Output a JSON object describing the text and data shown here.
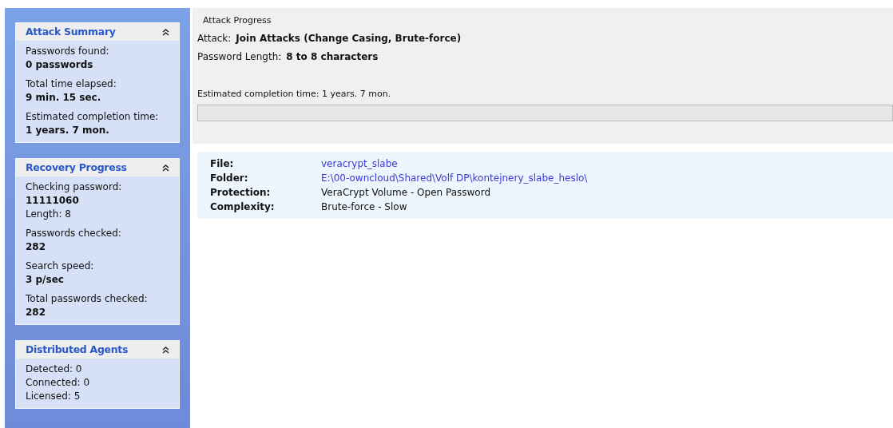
{
  "sidebar": {
    "panels": [
      {
        "title": "Attack Summary",
        "expanded": true,
        "rows": [
          {
            "kind": "pair",
            "label": "Passwords found:",
            "value": "0 passwords"
          },
          {
            "kind": "pair",
            "label": "Total time elapsed:",
            "value": "9 min. 15 sec."
          },
          {
            "kind": "pair",
            "label": "Estimated completion time:",
            "value": "1 years. 7 mon."
          }
        ]
      },
      {
        "title": "Recovery Progress",
        "expanded": true,
        "rows": [
          {
            "kind": "pair",
            "label": "Checking password:",
            "value": "11111060"
          },
          {
            "kind": "line",
            "text": "Length: 8"
          },
          {
            "kind": "pair",
            "label": "Passwords checked:",
            "value": "282"
          },
          {
            "kind": "pair",
            "label": "Search speed:",
            "value": "3 p/sec"
          },
          {
            "kind": "pair",
            "label": "Total passwords checked:",
            "value": "282"
          }
        ]
      },
      {
        "title": "Distributed Agents",
        "expanded": true,
        "rows": [
          {
            "kind": "line",
            "text": "Detected: 0"
          },
          {
            "kind": "line",
            "text": "Connected: 0"
          },
          {
            "kind": "line",
            "text": "Licensed: 5"
          }
        ]
      }
    ]
  },
  "attack_progress": {
    "title": "Attack Progress",
    "attack_label": "Attack:",
    "attack": "Join Attacks (Change Casing, Brute-force)",
    "length_label": "Password Length:",
    "length": "8 to 8 characters",
    "estimate": "Estimated completion time: 1 years. 7 mon.",
    "progress": {
      "level": 0
    }
  },
  "details": [
    {
      "label": "File:",
      "value": "veracrypt_slabe",
      "kind": "link"
    },
    {
      "label": "Folder:",
      "value": "E:\\00-owncloud\\Shared\\Volf DP\\kontejnery_slabe_heslo\\",
      "kind": "link"
    },
    {
      "label": "Protection:",
      "value": "VeraCrypt Volume - Open Password",
      "kind": "text"
    },
    {
      "label": "Complexity:",
      "value": "Brute-force - Slow",
      "kind": "text"
    }
  ]
}
